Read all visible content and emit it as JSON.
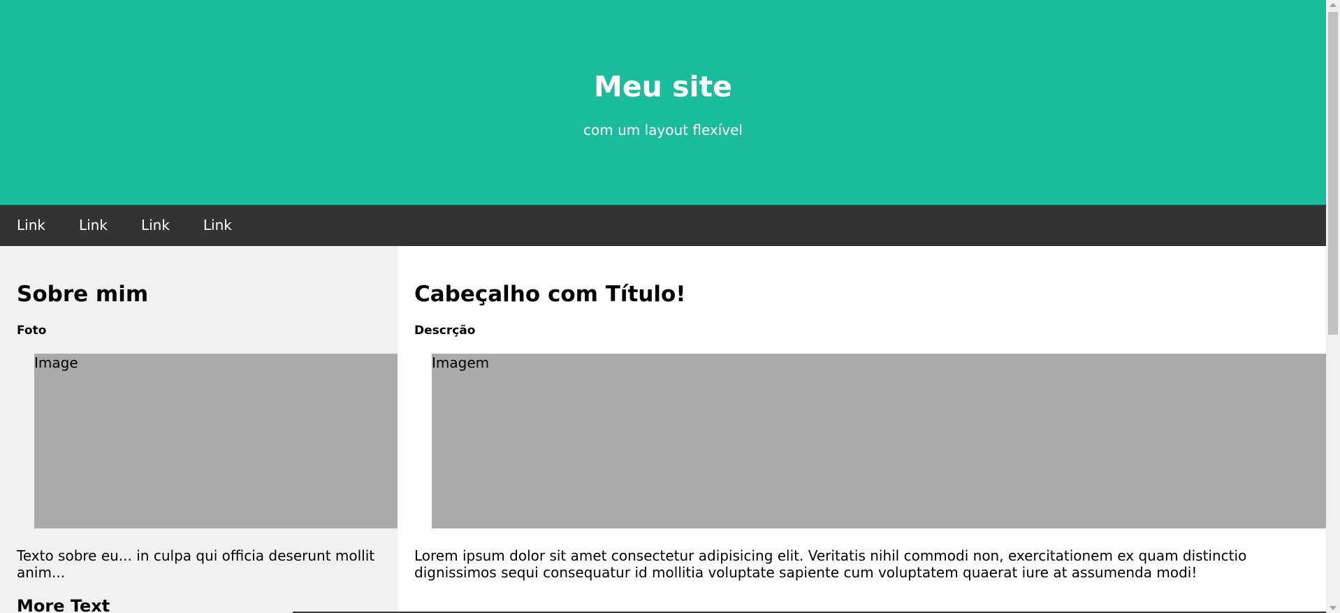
{
  "header": {
    "title": "Meu site",
    "subtitle": "com um layout flexível"
  },
  "navbar": {
    "links": [
      "Link",
      "Link",
      "Link",
      "Link"
    ]
  },
  "sidebar": {
    "title": "Sobre mim",
    "subtitle": "Foto",
    "image_label": "Image",
    "text": "Texto sobre eu... in culpa qui officia deserunt mollit anim...",
    "more_title": "More Text"
  },
  "main": {
    "title": "Cabeçalho com Título!",
    "subtitle": "Descrção",
    "image_label": "Imagem",
    "text": "Lorem ipsum dolor sit amet consectetur adipisicing elit. Veritatis nihil commodi non, exercitationem ex quam distinctio dignissimos sequi consequatur id mollitia voluptate sapiente cum voluptatem quaerat iure at assumenda modi!"
  },
  "colors": {
    "header_bg": "#1abc9c",
    "navbar_bg": "#333333",
    "side_bg": "#f1f1f1",
    "image_placeholder": "#aaaaaa"
  }
}
